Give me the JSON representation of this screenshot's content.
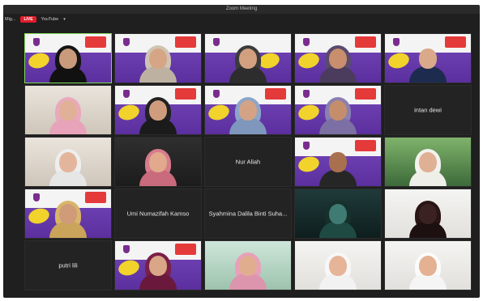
{
  "window": {
    "title": "Zoom Meeting"
  },
  "toolbar": {
    "left_label": "Mig...",
    "live_badge": "LIVE",
    "stream_label": "YouTube",
    "chevron": "▾"
  },
  "tiles": [
    {
      "type": "poster",
      "active": true
    },
    {
      "type": "poster"
    },
    {
      "type": "poster"
    },
    {
      "type": "poster"
    },
    {
      "type": "poster"
    },
    {
      "type": "room"
    },
    {
      "type": "poster"
    },
    {
      "type": "poster"
    },
    {
      "type": "poster"
    },
    {
      "type": "name",
      "label": "intan dewi"
    },
    {
      "type": "room"
    },
    {
      "type": "dark"
    },
    {
      "type": "name",
      "label": "Nur Aliah"
    },
    {
      "type": "poster"
    },
    {
      "type": "green"
    },
    {
      "type": "poster"
    },
    {
      "type": "name",
      "label": "Umi Numazifah Kamso"
    },
    {
      "type": "name",
      "label": "Syahmina Dalila Binti Suha..."
    },
    {
      "type": "anime"
    },
    {
      "type": "white"
    },
    {
      "type": "name",
      "label": "putri lili"
    },
    {
      "type": "poster"
    },
    {
      "type": "white"
    },
    {
      "type": "white"
    },
    {
      "type": "white"
    }
  ],
  "colors": {
    "active_speaker_border": "#7ed957",
    "live": "#e21d2a"
  }
}
